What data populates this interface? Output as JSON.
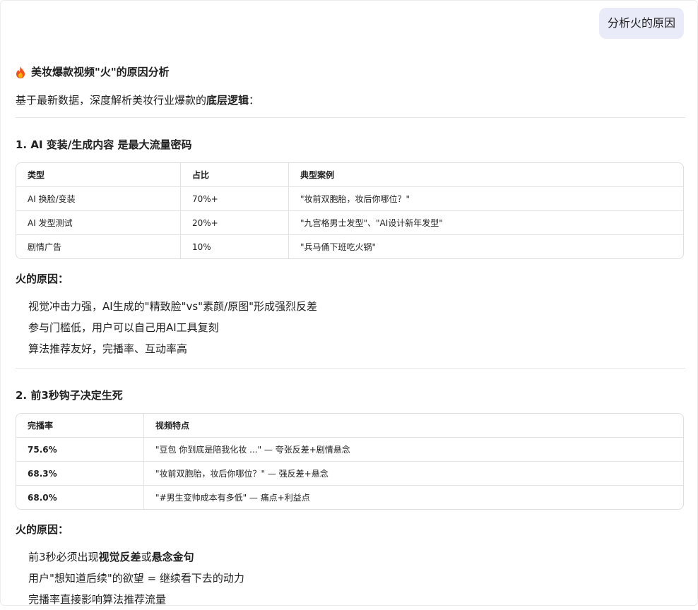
{
  "user_message": "分析火的原因",
  "title": "美妆爆款视频\"火\"的原因分析",
  "intro": {
    "prefix": "基于最新数据，深度解析美妆行业爆款的",
    "bold": "底层逻辑",
    "suffix": "："
  },
  "section1": {
    "heading": "1. AI 变装/生成内容 是最大流量密码",
    "headers": [
      "类型",
      "占比",
      "典型案例"
    ],
    "rows": [
      [
        "AI 换脸/变装",
        "70%+",
        "\"妆前双胞胎，妆后你哪位？\""
      ],
      [
        "AI 发型测试",
        "20%+",
        "\"九宫格男士发型\"、\"AI设计新年发型\""
      ],
      [
        "剧情广告",
        "10%",
        "\"兵马俑下班吃火锅\""
      ]
    ],
    "reason_heading": "火的原因：",
    "reasons": [
      "视觉冲击力强，AI生成的\"精致脸\"vs\"素颜/原图\"形成强烈反差",
      "参与门槛低，用户可以自己用AI工具复刻",
      "算法推荐友好，完播率、互动率高"
    ]
  },
  "section2": {
    "heading": "2. 前3秒钩子决定生死",
    "headers": [
      "完播率",
      "视频特点"
    ],
    "rows": [
      [
        "75.6%",
        "\"豆包 你到底是陪我化妆 ...\" — 夸张反差+剧情悬念"
      ],
      [
        "68.3%",
        "\"妆前双胞胎，妆后你哪位？\" — 强反差+悬念"
      ],
      [
        "68.0%",
        "\"#男生变帅成本有多低\" — 痛点+利益点"
      ]
    ],
    "reason_heading": "火的原因：",
    "reason1": {
      "prefix": "前3秒必须出现",
      "bold1": "视觉反差",
      "mid": "或",
      "bold2": "悬念金句"
    },
    "reason2": "用户\"想知道后续\"的欲望 = 继续看下去的动力",
    "reason3": "完播率直接影响算法推荐流量"
  }
}
